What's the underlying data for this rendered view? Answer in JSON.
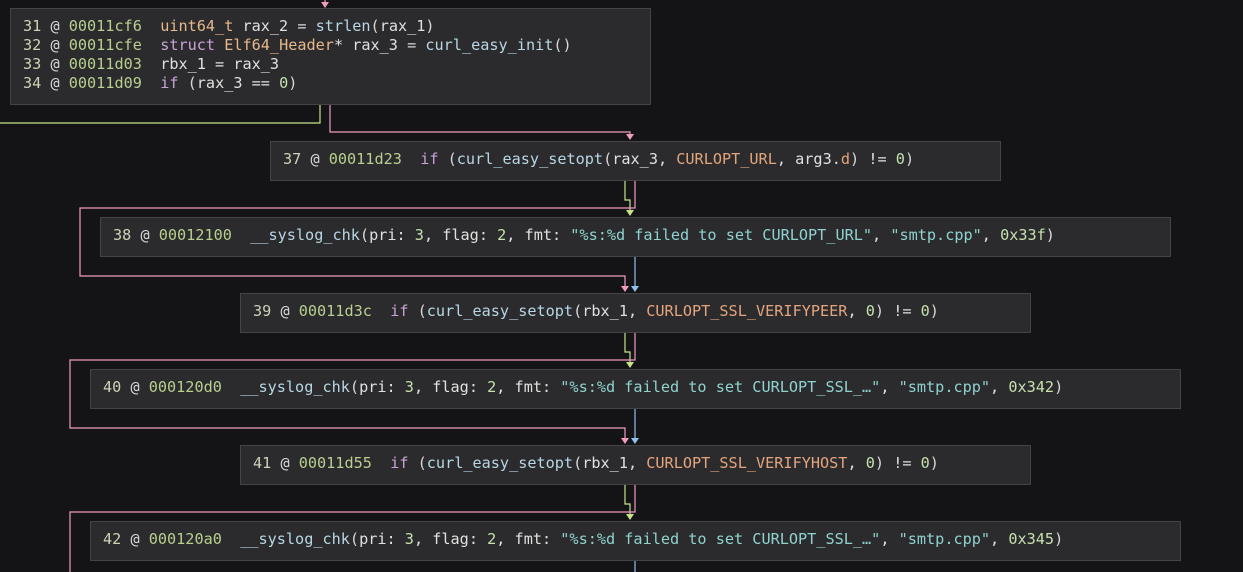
{
  "colors": {
    "background": "#141416",
    "block_background": "#2b2b2d",
    "block_border": "#444447",
    "edge_true": "#c6e38c",
    "edge_false": "#f09cc0",
    "edge_unconditional": "#8fc2ee"
  },
  "blocks": [
    {
      "name": "block-34",
      "lines": [
        [
          [
            "ln",
            "31"
          ],
          [
            "at",
            " @ "
          ],
          [
            "addr",
            "00011cf6"
          ],
          [
            "p",
            "  "
          ],
          [
            "ty",
            "uint64_t"
          ],
          [
            "var",
            " rax_2 "
          ],
          [
            "p",
            "= "
          ],
          [
            "fn",
            "strlen"
          ],
          [
            "p",
            "("
          ],
          [
            "var",
            "rax_1"
          ],
          [
            "p",
            ")"
          ]
        ],
        [
          [
            "ln",
            "32"
          ],
          [
            "at",
            " @ "
          ],
          [
            "addr",
            "00011cfe"
          ],
          [
            "p",
            "  "
          ],
          [
            "kw",
            "struct"
          ],
          [
            "ty",
            " Elf64_Header"
          ],
          [
            "var",
            "* rax_3 "
          ],
          [
            "p",
            "= "
          ],
          [
            "fn",
            "curl_easy_init"
          ],
          [
            "p",
            "()"
          ]
        ],
        [
          [
            "ln",
            "33"
          ],
          [
            "at",
            " @ "
          ],
          [
            "addr",
            "00011d03"
          ],
          [
            "p",
            "  "
          ],
          [
            "var",
            "rbx_1 = rax_3"
          ]
        ],
        [
          [
            "ln",
            "34"
          ],
          [
            "at",
            " @ "
          ],
          [
            "addr",
            "00011d09"
          ],
          [
            "p",
            "  "
          ],
          [
            "kw",
            "if"
          ],
          [
            "p",
            " ("
          ],
          [
            "var",
            "rax_3 == "
          ],
          [
            "num",
            "0"
          ],
          [
            "p",
            ")"
          ]
        ]
      ]
    },
    {
      "name": "block-37",
      "lines": [
        [
          [
            "ln",
            "37"
          ],
          [
            "at",
            " @ "
          ],
          [
            "addr",
            "00011d23"
          ],
          [
            "p",
            "  "
          ],
          [
            "kw",
            "if"
          ],
          [
            "p",
            " ("
          ],
          [
            "fn",
            "curl_easy_setopt"
          ],
          [
            "p",
            "("
          ],
          [
            "var",
            "rax_3, "
          ],
          [
            "const",
            "CURLOPT_URL"
          ],
          [
            "var",
            ", arg3"
          ],
          [
            "p",
            "."
          ],
          [
            "const",
            "d"
          ],
          [
            "p",
            ")"
          ],
          [
            "var",
            " != "
          ],
          [
            "num",
            "0"
          ],
          [
            "p",
            ")"
          ]
        ]
      ]
    },
    {
      "name": "block-38",
      "lines": [
        [
          [
            "ln",
            "38"
          ],
          [
            "at",
            " @ "
          ],
          [
            "addr",
            "00012100"
          ],
          [
            "p",
            "  "
          ],
          [
            "fn",
            "__syslog_chk"
          ],
          [
            "p",
            "("
          ],
          [
            "var",
            "pri: "
          ],
          [
            "num",
            "3"
          ],
          [
            "var",
            ", flag: "
          ],
          [
            "num",
            "2"
          ],
          [
            "var",
            ", fmt: "
          ],
          [
            "str",
            "\"%s:%d failed to set CURLOPT_URL\""
          ],
          [
            "var",
            ", "
          ],
          [
            "str",
            "\"smtp.cpp\""
          ],
          [
            "var",
            ", "
          ],
          [
            "num",
            "0x33f"
          ],
          [
            "p",
            ")"
          ]
        ]
      ]
    },
    {
      "name": "block-39",
      "lines": [
        [
          [
            "ln",
            "39"
          ],
          [
            "at",
            " @ "
          ],
          [
            "addr",
            "00011d3c"
          ],
          [
            "p",
            "  "
          ],
          [
            "kw",
            "if"
          ],
          [
            "p",
            " ("
          ],
          [
            "fn",
            "curl_easy_setopt"
          ],
          [
            "p",
            "("
          ],
          [
            "var",
            "rbx_1, "
          ],
          [
            "const",
            "CURLOPT_SSL_VERIFYPEER"
          ],
          [
            "var",
            ", "
          ],
          [
            "num",
            "0"
          ],
          [
            "p",
            ")"
          ],
          [
            "var",
            " != "
          ],
          [
            "num",
            "0"
          ],
          [
            "p",
            ")"
          ]
        ]
      ]
    },
    {
      "name": "block-40",
      "lines": [
        [
          [
            "ln",
            "40"
          ],
          [
            "at",
            " @ "
          ],
          [
            "addr",
            "000120d0"
          ],
          [
            "p",
            "  "
          ],
          [
            "fn",
            "__syslog_chk"
          ],
          [
            "p",
            "("
          ],
          [
            "var",
            "pri: "
          ],
          [
            "num",
            "3"
          ],
          [
            "var",
            ", flag: "
          ],
          [
            "num",
            "2"
          ],
          [
            "var",
            ", fmt: "
          ],
          [
            "str",
            "\"%s:%d failed to set CURLOPT_SSL_…\""
          ],
          [
            "var",
            ", "
          ],
          [
            "str",
            "\"smtp.cpp\""
          ],
          [
            "var",
            ", "
          ],
          [
            "num",
            "0x342"
          ],
          [
            "p",
            ")"
          ]
        ]
      ]
    },
    {
      "name": "block-41",
      "lines": [
        [
          [
            "ln",
            "41"
          ],
          [
            "at",
            " @ "
          ],
          [
            "addr",
            "00011d55"
          ],
          [
            "p",
            "  "
          ],
          [
            "kw",
            "if"
          ],
          [
            "p",
            " ("
          ],
          [
            "fn",
            "curl_easy_setopt"
          ],
          [
            "p",
            "("
          ],
          [
            "var",
            "rbx_1, "
          ],
          [
            "const",
            "CURLOPT_SSL_VERIFYHOST"
          ],
          [
            "var",
            ", "
          ],
          [
            "num",
            "0"
          ],
          [
            "p",
            ")"
          ],
          [
            "var",
            " != "
          ],
          [
            "num",
            "0"
          ],
          [
            "p",
            ")"
          ]
        ]
      ]
    },
    {
      "name": "block-42",
      "lines": [
        [
          [
            "ln",
            "42"
          ],
          [
            "at",
            " @ "
          ],
          [
            "addr",
            "000120a0"
          ],
          [
            "p",
            "  "
          ],
          [
            "fn",
            "__syslog_chk"
          ],
          [
            "p",
            "("
          ],
          [
            "var",
            "pri: "
          ],
          [
            "num",
            "3"
          ],
          [
            "var",
            ", flag: "
          ],
          [
            "num",
            "2"
          ],
          [
            "var",
            ", fmt: "
          ],
          [
            "str",
            "\"%s:%d failed to set CURLOPT_SSL_…\""
          ],
          [
            "var",
            ", "
          ],
          [
            "str",
            "\"smtp.cpp\""
          ],
          [
            "var",
            ", "
          ],
          [
            "num",
            "0x345"
          ],
          [
            "p",
            ")"
          ]
        ]
      ]
    }
  ]
}
